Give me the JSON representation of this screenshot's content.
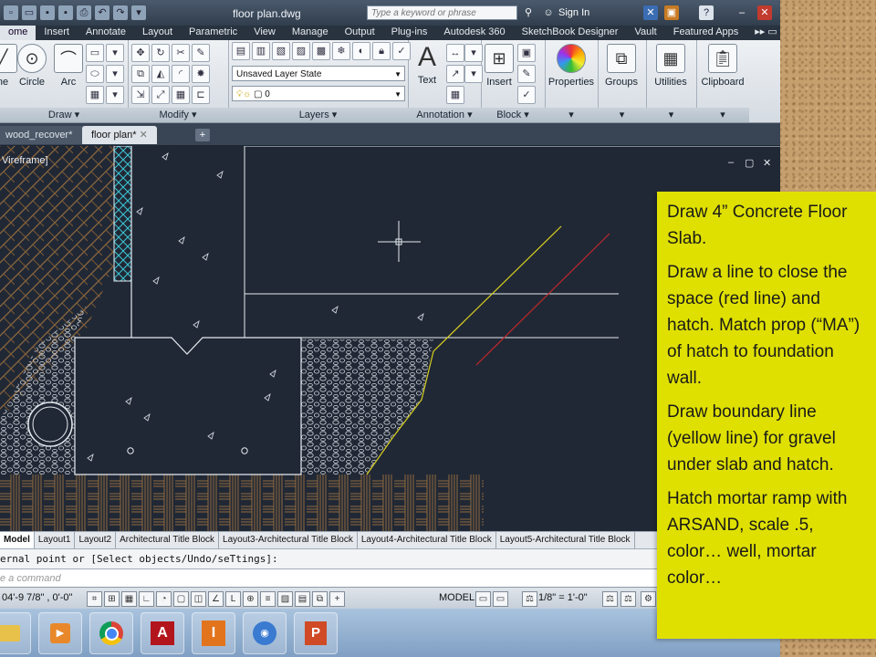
{
  "window": {
    "title": "floor plan.dwg",
    "search_placeholder": "Type a keyword or phrase",
    "signin": "Sign In"
  },
  "ribbon_tabs": [
    "ome",
    "Insert",
    "Annotate",
    "Layout",
    "Parametric",
    "View",
    "Manage",
    "Output",
    "Plug-ins",
    "Autodesk 360",
    "SketchBook Designer",
    "Vault",
    "Featured Apps"
  ],
  "ribbon": {
    "draw": {
      "title": "Draw",
      "line_partial": "ne",
      "circle": "Circle",
      "arc": "Arc"
    },
    "modify": {
      "title": "Modify"
    },
    "layers": {
      "title": "Layers",
      "layer_state": "Unsaved Layer State",
      "current_layer": "0"
    },
    "annotation": {
      "title": "Annotation",
      "text": "Text"
    },
    "block": {
      "title": "Block",
      "insert": "Insert"
    },
    "properties": "Properties",
    "groups": "Groups",
    "utilities": "Utilities",
    "clipboard": "Clipboard"
  },
  "doc_tabs": [
    "wood_recover*",
    "floor plan*"
  ],
  "viewport": {
    "label": "Vireframe]"
  },
  "layout_tabs": [
    "Model",
    "Layout1",
    "Layout2",
    "Architectural Title Block",
    "Layout3-Architectural Title Block",
    "Layout4-Architectural Title Block",
    "Layout5-Architectural Title Block"
  ],
  "command": {
    "history": "ernal point or [Select objects/Undo/seTtings]:",
    "prompt": "e a command"
  },
  "status": {
    "coords": "04'-9 7/8\" , 0'-0\"",
    "model": "MODEL",
    "scale": "1/8\" = 1'-0\""
  },
  "note": {
    "p1": "Draw 4” Concrete Floor Slab.",
    "p2": "Draw a line to close the space (red line) and hatch.  Match prop (“MA”) of hatch to foundation wall.",
    "p3": "Draw boundary line (yellow line) for gravel under slab and hatch.",
    "p4": "Hatch mortar ramp with ARSAND, scale .5, color… well, mortar color…"
  },
  "colors": {
    "canvas": "#212835",
    "note_bg": "#dfe000",
    "red_line": "#c0282a",
    "yellow_line": "#d8d020"
  }
}
